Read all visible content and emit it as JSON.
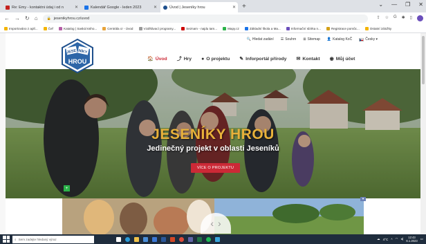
{
  "browser": {
    "tabs": [
      {
        "label": "Re: Emy - kontaktni údaj i od n",
        "favicon_color": "#c5221f",
        "active": false
      },
      {
        "label": "Kalendář Google - leden 2023",
        "favicon_color": "#1a73e8",
        "active": false
      },
      {
        "label": "Úvod | Jeseníky hrou",
        "favicon_color": "#1e4f8c",
        "active": true
      }
    ],
    "new_tab_label": "+",
    "window_controls": [
      "⌄",
      "—",
      "❐",
      "✕"
    ],
    "url": "jesenikyhrou.cz/uvod",
    "bookmarks": [
      {
        "label": "Importováno z aplí...",
        "color": "#f4b400"
      },
      {
        "label": "Čeř",
        "color": "#f4b400"
      },
      {
        "label": "Katalog | Saská kniho...",
        "color": "#b55ea6"
      },
      {
        "label": "Centrála cr - Úvod",
        "color": "#e8a33a"
      },
      {
        "label": "Vzdělávací programy...",
        "color": "#999999"
      },
      {
        "label": "Seznam - najdu tam...",
        "color": "#cc0000"
      },
      {
        "label": "Mapy.cz",
        "color": "#2cb34a"
      },
      {
        "label": "Základní škola a Ma...",
        "color": "#1a73e8"
      },
      {
        "label": "Informační sbírka n...",
        "color": "#6b4fbb"
      },
      {
        "label": "Registrace pomůc...",
        "color": "#d4a017"
      },
      {
        "label": "Ostatní záložky",
        "color": "#f4b400"
      }
    ]
  },
  "site": {
    "logo_text_top": "JESE NÍKY",
    "logo_text_bottom": "HROU",
    "utility_links": [
      {
        "label": "Hledat zadání",
        "icon": "search-icon"
      },
      {
        "label": "Souhrn",
        "icon": "list-icon"
      },
      {
        "label": "Sitemap",
        "icon": "sitemap-icon"
      },
      {
        "label": "Katalog KoČ",
        "icon": "user-icon"
      },
      {
        "label": "Česky ▾",
        "icon": "flag-icon"
      }
    ],
    "nav": [
      {
        "label": "Úvod",
        "icon": "🏠",
        "active": true
      },
      {
        "label": "Hry",
        "icon": "⤴",
        "active": false
      },
      {
        "label": "O projektu",
        "icon": "●",
        "active": false
      },
      {
        "label": "Inforportál přírody",
        "icon": "✎",
        "active": false
      },
      {
        "label": "Kontakt",
        "icon": "✉",
        "active": false
      },
      {
        "label": "Můj účet",
        "icon": "◉",
        "active": false
      }
    ],
    "hero": {
      "title": "JESENÍKY HROU",
      "subtitle": "Jedinečný projekt v oblasti Jeseníků",
      "button_label": "VÍCE O PROJEKTU"
    },
    "slider_prev": "‹",
    "slider_next": "›",
    "green_square_label": "+",
    "collapse_label": "▾"
  },
  "taskbar": {
    "search_placeholder": "Sem zadejte hledaný výraz",
    "weather": "4°C",
    "time": "12:43",
    "date": "6.1.2023",
    "colors": {
      "bg": "#1f2d3d"
    }
  },
  "colors": {
    "accent_red": "#cc2936",
    "hero_title": "#e8b13a",
    "logo_blue": "#1e4f8c"
  }
}
